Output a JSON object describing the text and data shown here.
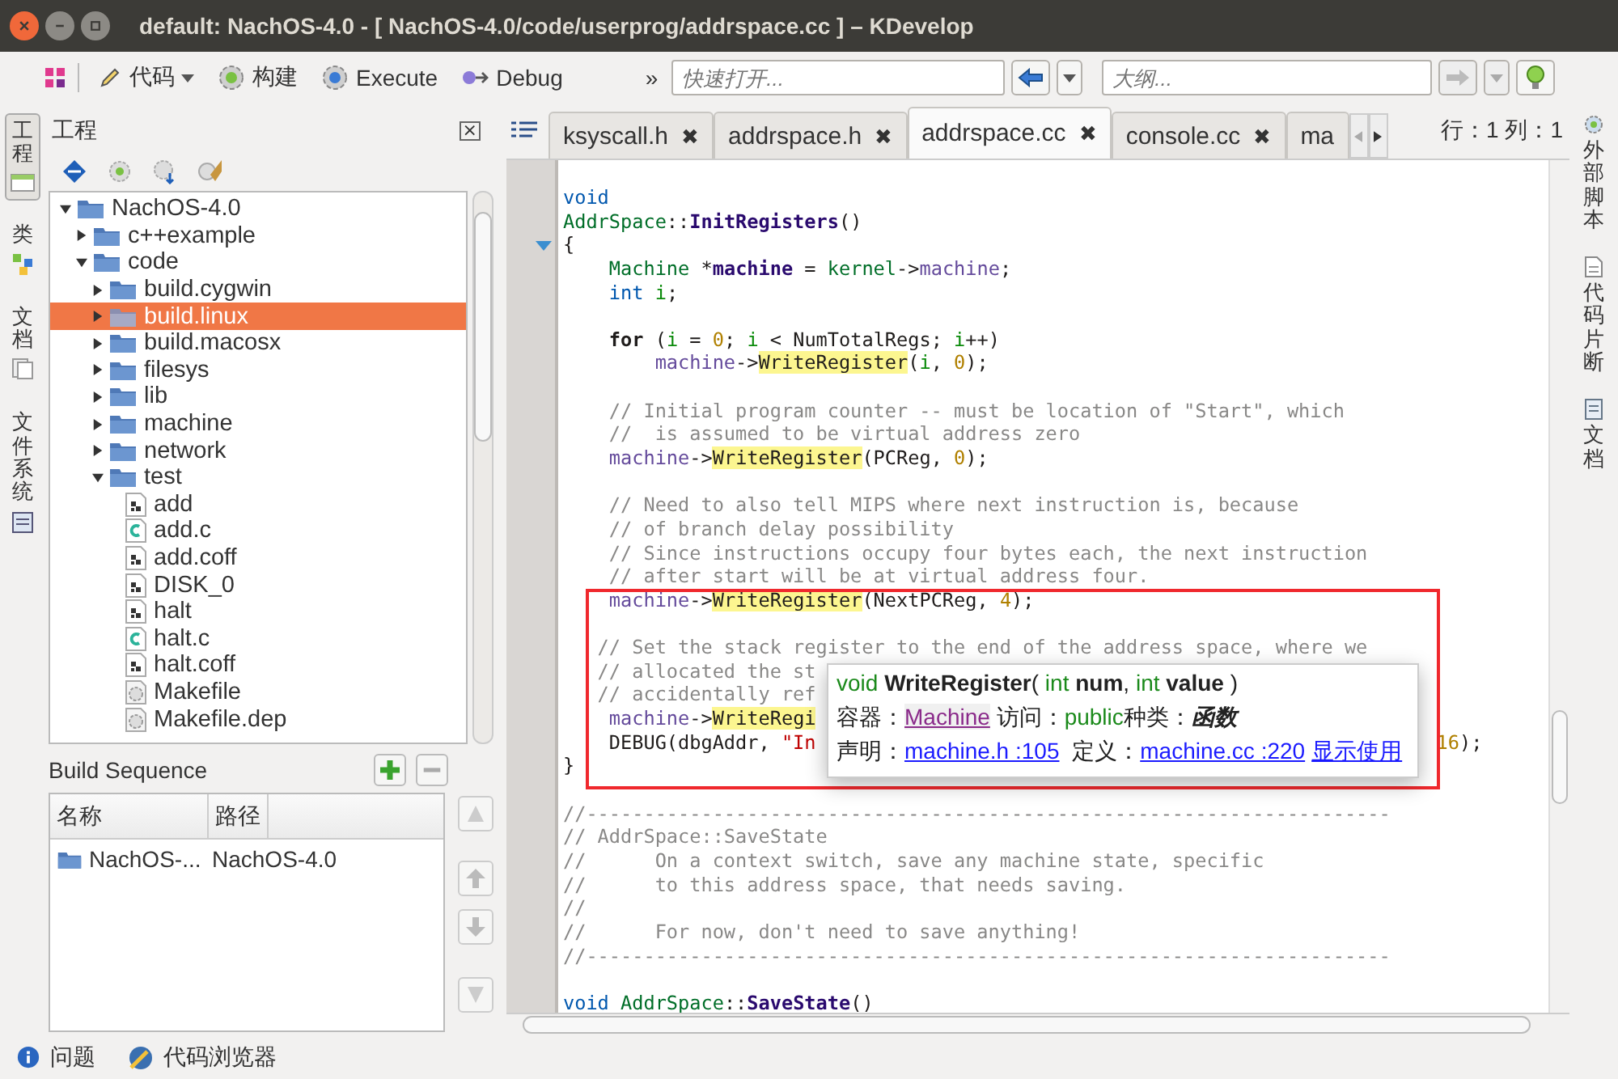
{
  "window": {
    "title": "default:  NachOS-4.0 - [ NachOS-4.0/code/userprog/addrspace.cc ] – KDevelop"
  },
  "toolbar": {
    "items": [
      {
        "label": "代码",
        "kind": "menu"
      },
      {
        "label": "构建",
        "kind": "build"
      },
      {
        "label": "Execute",
        "kind": "execute"
      },
      {
        "label": "Debug",
        "kind": "debug"
      }
    ],
    "more": "»",
    "quick_open": {
      "placeholder": "快速打开..."
    },
    "outline": {
      "placeholder": "大纲..."
    }
  },
  "left_tabs": [
    {
      "label": "工程",
      "selected": true,
      "kind": "project"
    },
    {
      "label": "类",
      "selected": false,
      "kind": "classes"
    },
    {
      "label": "文档",
      "selected": false,
      "kind": "docs"
    },
    {
      "label": "文件系统",
      "selected": false,
      "kind": "files"
    }
  ],
  "right_tabs": [
    {
      "label": "外部脚本",
      "kind": "scripts"
    },
    {
      "label": "代码片断",
      "kind": "snippets"
    },
    {
      "label": "文档",
      "kind": "docs"
    }
  ],
  "project_panel": {
    "title": "工程",
    "close": "×"
  },
  "tree": [
    {
      "name": "NachOS-4.0",
      "kind": "folder",
      "expanded": true,
      "selected": false,
      "children": [
        {
          "name": "c++example",
          "kind": "folder",
          "expanded": false,
          "selected": false
        },
        {
          "name": "code",
          "kind": "folder",
          "expanded": true,
          "selected": false,
          "children": [
            {
              "name": "build.cygwin",
              "kind": "folder",
              "expanded": false,
              "selected": false
            },
            {
              "name": "build.linux",
              "kind": "folder",
              "expanded": false,
              "selected": true
            },
            {
              "name": "build.macosx",
              "kind": "folder",
              "expanded": false,
              "selected": false
            },
            {
              "name": "filesys",
              "kind": "folder",
              "expanded": false,
              "selected": false
            },
            {
              "name": "lib",
              "kind": "folder",
              "expanded": false,
              "selected": false
            },
            {
              "name": "machine",
              "kind": "folder",
              "expanded": false,
              "selected": false
            },
            {
              "name": "network",
              "kind": "folder",
              "expanded": false,
              "selected": false
            },
            {
              "name": "test",
              "kind": "folder",
              "expanded": true,
              "selected": false,
              "children": [
                {
                  "name": "add",
                  "kind": "binary",
                  "selected": false
                },
                {
                  "name": "add.c",
                  "kind": "csource",
                  "selected": false
                },
                {
                  "name": "add.coff",
                  "kind": "binary",
                  "selected": false
                },
                {
                  "name": "DISK_0",
                  "kind": "binary",
                  "selected": false
                },
                {
                  "name": "halt",
                  "kind": "binary",
                  "selected": false
                },
                {
                  "name": "halt.c",
                  "kind": "csource",
                  "selected": false
                },
                {
                  "name": "halt.coff",
                  "kind": "binary",
                  "selected": false
                },
                {
                  "name": "Makefile",
                  "kind": "makefile",
                  "selected": false
                },
                {
                  "name": "Makefile.dep",
                  "kind": "makefile",
                  "selected": false
                }
              ]
            }
          ]
        }
      ]
    }
  ],
  "build_sequence": {
    "title": "Build Sequence",
    "columns": [
      "名称",
      "路径"
    ],
    "rows": [
      {
        "cells": [
          "NachOS-...",
          "NachOS-4.0"
        ]
      }
    ]
  },
  "editor": {
    "tabs": [
      {
        "label": "ksyscall.h",
        "selected": false,
        "close": "✖"
      },
      {
        "label": "addrspace.h",
        "selected": false,
        "close": "✖"
      },
      {
        "label": "addrspace.cc",
        "selected": true,
        "close": "✖"
      },
      {
        "label": "console.cc",
        "selected": false,
        "close": "✖"
      },
      {
        "label": "ma",
        "selected": false
      }
    ],
    "position": "行：1 列：1",
    "lines": [
      {
        "kind": "code",
        "segs": [
          {
            "text": "void",
            "kind": "kw"
          }
        ]
      },
      {
        "kind": "code",
        "segs": [
          {
            "text": "AddrSpace",
            "kind": "type"
          },
          {
            "text": "::",
            "kind": "plain"
          },
          {
            "text": "InitRegisters",
            "kind": "fn"
          },
          {
            "text": "()",
            "kind": "plain"
          }
        ]
      },
      {
        "kind": "code",
        "fold": true,
        "segs": [
          {
            "text": "{",
            "kind": "plain"
          }
        ]
      },
      {
        "kind": "code",
        "segs": [
          {
            "text": "    Machine",
            "kind": "type"
          },
          {
            "text": " *",
            "kind": "plain"
          },
          {
            "text": "machine",
            "kind": "fn"
          },
          {
            "text": " = ",
            "kind": "plain"
          },
          {
            "text": "kernel",
            "kind": "type"
          },
          {
            "text": "->",
            "kind": "plain"
          },
          {
            "text": "machine",
            "kind": "member"
          },
          {
            "text": ";",
            "kind": "plain"
          }
        ]
      },
      {
        "kind": "code",
        "segs": [
          {
            "text": "    int",
            "kind": "kw"
          },
          {
            "text": " i",
            "kind": "var"
          },
          {
            "text": ";",
            "kind": "plain"
          }
        ]
      },
      {
        "kind": "blank"
      },
      {
        "kind": "code",
        "segs": [
          {
            "text": "    for",
            "kind": "bold"
          },
          {
            "text": " (",
            "kind": "plain"
          },
          {
            "text": "i",
            "kind": "var"
          },
          {
            "text": " = ",
            "kind": "plain"
          },
          {
            "text": "0",
            "kind": "num"
          },
          {
            "text": "; ",
            "kind": "plain"
          },
          {
            "text": "i",
            "kind": "var"
          },
          {
            "text": " < NumTotalRegs; ",
            "kind": "plain"
          },
          {
            "text": "i",
            "kind": "var"
          },
          {
            "text": "++)",
            "kind": "plain"
          }
        ]
      },
      {
        "kind": "code",
        "segs": [
          {
            "text": "        machine",
            "kind": "member"
          },
          {
            "text": "->",
            "kind": "plain"
          },
          {
            "text": "WriteRegister",
            "kind": "mark"
          },
          {
            "text": "(",
            "kind": "plain"
          },
          {
            "text": "i",
            "kind": "var"
          },
          {
            "text": ", ",
            "kind": "plain"
          },
          {
            "text": "0",
            "kind": "num"
          },
          {
            "text": ");",
            "kind": "plain"
          }
        ]
      },
      {
        "kind": "blank"
      },
      {
        "kind": "code",
        "segs": [
          {
            "text": "    // Initial program counter -- must be location of \"Start\", which",
            "kind": "comment"
          }
        ]
      },
      {
        "kind": "code",
        "segs": [
          {
            "text": "    //  is assumed to be virtual address zero",
            "kind": "comment"
          }
        ]
      },
      {
        "kind": "code",
        "segs": [
          {
            "text": "    machine",
            "kind": "member"
          },
          {
            "text": "->",
            "kind": "plain"
          },
          {
            "text": "WriteRegister",
            "kind": "mark"
          },
          {
            "text": "(PCReg, ",
            "kind": "plain"
          },
          {
            "text": "0",
            "kind": "num"
          },
          {
            "text": ");",
            "kind": "plain"
          }
        ]
      },
      {
        "kind": "blank"
      },
      {
        "kind": "code",
        "segs": [
          {
            "text": "    // Need to also tell MIPS where next instruction is, because",
            "kind": "comment"
          }
        ]
      },
      {
        "kind": "code",
        "segs": [
          {
            "text": "    // of branch delay possibility",
            "kind": "comment"
          }
        ]
      },
      {
        "kind": "code",
        "segs": [
          {
            "text": "    // Since instructions occupy four bytes each, the next instruction",
            "kind": "comment"
          }
        ]
      },
      {
        "kind": "code",
        "segs": [
          {
            "text": "    // after start will be at virtual address four.",
            "kind": "comment"
          }
        ]
      },
      {
        "kind": "code",
        "segs": [
          {
            "text": "    machine",
            "kind": "member"
          },
          {
            "text": "->",
            "kind": "plain"
          },
          {
            "text": "WriteRegister",
            "kind": "mark"
          },
          {
            "text": "(NextPCReg, ",
            "kind": "plain"
          },
          {
            "text": "4",
            "kind": "num"
          },
          {
            "text": ");",
            "kind": "plain"
          }
        ]
      },
      {
        "kind": "blank"
      },
      {
        "kind": "code",
        "segs": [
          {
            "text": "   // Set the stack register to the end of the address space, where we",
            "kind": "comment"
          }
        ]
      },
      {
        "kind": "code",
        "segs": [
          {
            "text": "   // allocated the st",
            "kind": "comment"
          }
        ]
      },
      {
        "kind": "code",
        "segs": [
          {
            "text": "   // accidentally ref",
            "kind": "comment"
          }
        ]
      },
      {
        "kind": "code",
        "segs": [
          {
            "text": "    machine",
            "kind": "member"
          },
          {
            "text": "->",
            "kind": "plain"
          },
          {
            "text": "WriteRegi",
            "kind": "mark"
          }
        ]
      },
      {
        "kind": "code",
        "segs": [
          {
            "text": "    DEBUG(dbgAddr, ",
            "kind": "plain"
          },
          {
            "text": "\"In",
            "kind": "str"
          }
        ],
        "tail": [
          {
            "text": "16",
            "kind": "num"
          },
          {
            "text": ");",
            "kind": "plain"
          }
        ]
      },
      {
        "kind": "code",
        "segs": [
          {
            "text": "}",
            "kind": "plain"
          }
        ]
      },
      {
        "kind": "blank"
      },
      {
        "kind": "code",
        "segs": [
          {
            "text": "//----------------------------------------------------------------------",
            "kind": "comment"
          }
        ]
      },
      {
        "kind": "code",
        "segs": [
          {
            "text": "// AddrSpace::SaveState",
            "kind": "comment"
          }
        ]
      },
      {
        "kind": "code",
        "segs": [
          {
            "text": "//      On a context switch, save any machine state, specific",
            "kind": "comment"
          }
        ]
      },
      {
        "kind": "code",
        "segs": [
          {
            "text": "//      to this address space, that needs saving.",
            "kind": "comment"
          }
        ]
      },
      {
        "kind": "code",
        "segs": [
          {
            "text": "//",
            "kind": "comment"
          }
        ]
      },
      {
        "kind": "code",
        "segs": [
          {
            "text": "//      For now, don't need to save anything!",
            "kind": "comment"
          }
        ]
      },
      {
        "kind": "code",
        "segs": [
          {
            "text": "//----------------------------------------------------------------------",
            "kind": "comment"
          }
        ]
      },
      {
        "kind": "blank"
      },
      {
        "kind": "code",
        "segs": [
          {
            "text": "void",
            "kind": "kw"
          },
          {
            "text": " AddrSpace",
            "kind": "type"
          },
          {
            "text": "::",
            "kind": "plain"
          },
          {
            "text": "SaveState",
            "kind": "fn"
          },
          {
            "text": "()",
            "kind": "plain"
          }
        ]
      }
    ],
    "tooltip": {
      "signature": [
        {
          "text": "void",
          "kind": "kw"
        },
        {
          "text": " WriteRegister",
          "kind": "bold"
        },
        {
          "text": "( ",
          "kind": "plain"
        },
        {
          "text": "int",
          "kind": "kw"
        },
        {
          "text": " num",
          "kind": "bold"
        },
        {
          "text": ", ",
          "kind": "plain"
        },
        {
          "text": "int",
          "kind": "kw"
        },
        {
          "text": " value",
          "kind": "bold"
        },
        {
          "text": " )",
          "kind": "plain"
        }
      ],
      "lines": [
        {
          "segs": [
            {
              "text": "容器：",
              "kind": "plain"
            },
            {
              "text": "Machine",
              "kind": "classlink"
            },
            {
              "text": " 访问：",
              "kind": "plain"
            },
            {
              "text": "public",
              "kind": "kw"
            },
            {
              "text": "种类：",
              "kind": "plain"
            },
            {
              "text": "函数",
              "kind": "bolditalic"
            }
          ]
        },
        {
          "segs": [
            {
              "text": "声明：",
              "kind": "plain"
            },
            {
              "text": "machine.h :105",
              "kind": "link"
            },
            {
              "text": " 定义：",
              "kind": "plain"
            },
            {
              "text": "machine.cc :220",
              "kind": "link"
            },
            {
              "text": "显示使用",
              "kind": "link"
            }
          ]
        }
      ]
    },
    "highlight_frame": true
  },
  "status_bar": {
    "items": [
      {
        "label": "问题",
        "kind": "problems"
      },
      {
        "label": "代码浏览器",
        "kind": "browser"
      }
    ]
  }
}
